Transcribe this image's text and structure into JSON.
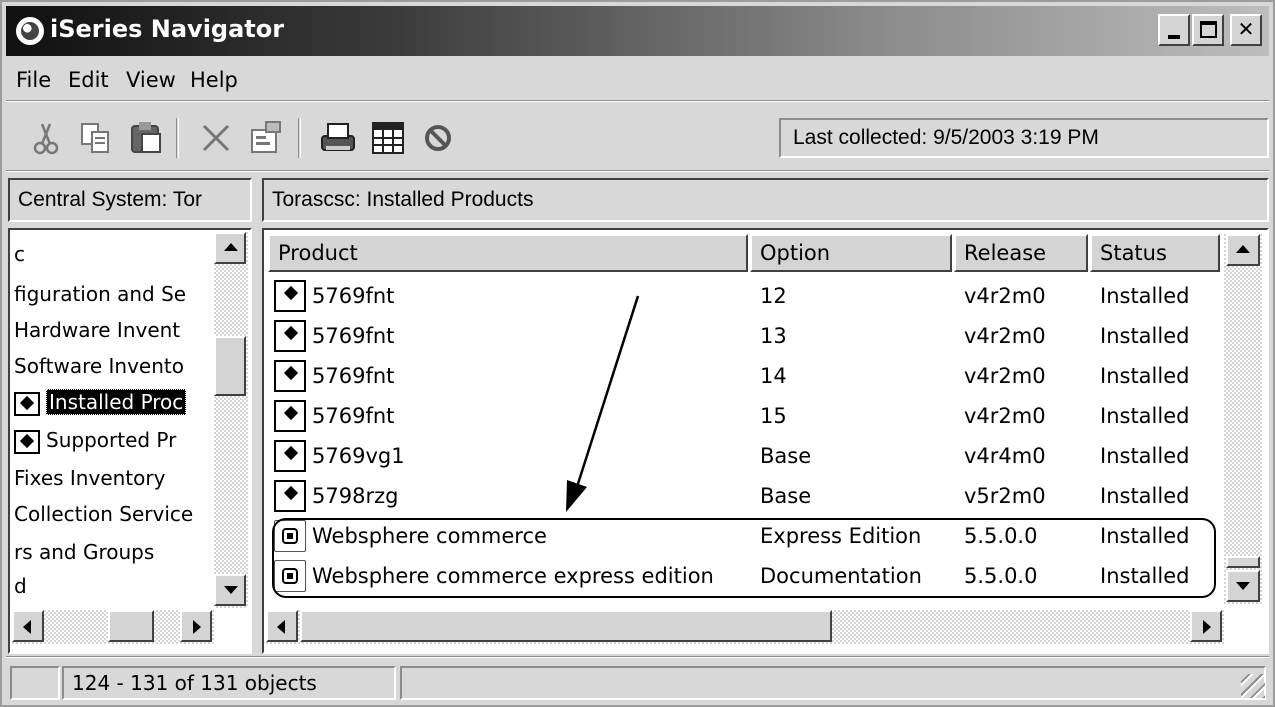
{
  "window": {
    "title": "iSeries Navigator"
  },
  "menu": [
    "File",
    "Edit",
    "View",
    "Help"
  ],
  "toolbar": {
    "icons": [
      "cut-icon",
      "copy-icon",
      "paste-icon",
      "delete-icon",
      "properties-icon",
      "print-icon",
      "columns-icon",
      "stop-icon"
    ],
    "last_collected": "Last collected: 9/5/2003 3:19 PM"
  },
  "left_pane": {
    "header": "Central System: Tor",
    "items": [
      "c",
      "figuration and Se",
      "Hardware Invent",
      "Software Invento",
      "Installed Proc",
      "Supported Pr",
      "Fixes Inventory",
      "Collection Service",
      "rs and Groups",
      "d"
    ]
  },
  "right_pane": {
    "header": "Torascsc:  Installed Products",
    "columns": [
      "Product",
      "Option",
      "Release",
      "Status"
    ],
    "rows": [
      {
        "product": "5769fnt",
        "option": "12",
        "release": "v4r2m0",
        "status": "Installed"
      },
      {
        "product": "5769fnt",
        "option": "13",
        "release": "v4r2m0",
        "status": "Installed"
      },
      {
        "product": "5769fnt",
        "option": "14",
        "release": "v4r2m0",
        "status": "Installed"
      },
      {
        "product": "5769fnt",
        "option": "15",
        "release": "v4r2m0",
        "status": "Installed"
      },
      {
        "product": "5769vg1",
        "option": "Base",
        "release": "v4r4m0",
        "status": "Installed"
      },
      {
        "product": "5798rzg",
        "option": "Base",
        "release": "v5r2m0",
        "status": "Installed"
      },
      {
        "product": "Websphere commerce",
        "option": "Express Edition",
        "release": "5.5.0.0",
        "status": "Installed"
      },
      {
        "product": "Websphere commerce express edition",
        "option": "Documentation",
        "release": "5.5.0.0",
        "status": "Installed"
      }
    ]
  },
  "status_bar": {
    "text": "124 - 131 of 131 objects"
  }
}
